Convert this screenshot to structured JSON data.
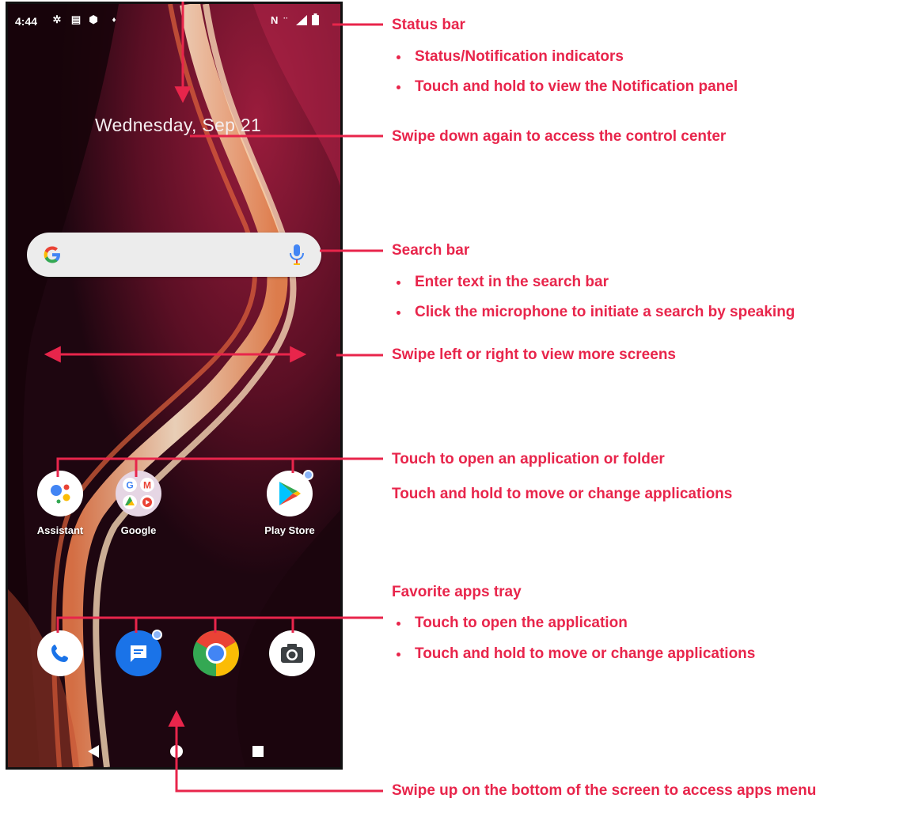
{
  "phone": {
    "status": {
      "time": "4:44",
      "network_letter": "N"
    },
    "date": "Wednesday, Sep 21",
    "search": {
      "logo_letter": "G"
    },
    "apps": [
      {
        "label": "Assistant",
        "icon": "assistant-icon"
      },
      {
        "label": "Google",
        "icon": "google-folder-icon"
      },
      {
        "label": "Play Store",
        "icon": "play-store-icon"
      }
    ],
    "dock": [
      {
        "icon": "phone-icon"
      },
      {
        "icon": "messages-icon"
      },
      {
        "icon": "chrome-icon"
      },
      {
        "icon": "camera-icon"
      }
    ]
  },
  "annotations": {
    "status_bar": {
      "title": "Status bar",
      "bullets": [
        "Status/Notification indicators",
        "Touch and hold to view the Notification panel"
      ]
    },
    "control_center": "Swipe down again to access the control center",
    "search_bar": {
      "title": "Search bar",
      "bullets": [
        "Enter text in the search bar",
        "Click the microphone to initiate a search by speaking"
      ]
    },
    "swipe_screens": "Swipe left or right to view more screens",
    "apps": {
      "line1": "Touch to open an application or folder",
      "line2": "Touch and hold to move or change applications"
    },
    "favorites": {
      "title": "Favorite apps tray",
      "bullets": [
        "Touch to open the application",
        "Touch and hold to move or change applications"
      ]
    },
    "apps_menu": "Swipe up on the bottom of the screen to access apps menu"
  },
  "colors": {
    "accent": "#e8254b",
    "wallpaper_dark": "#2a0812",
    "wallpaper_glow": "#f5c9a0"
  }
}
